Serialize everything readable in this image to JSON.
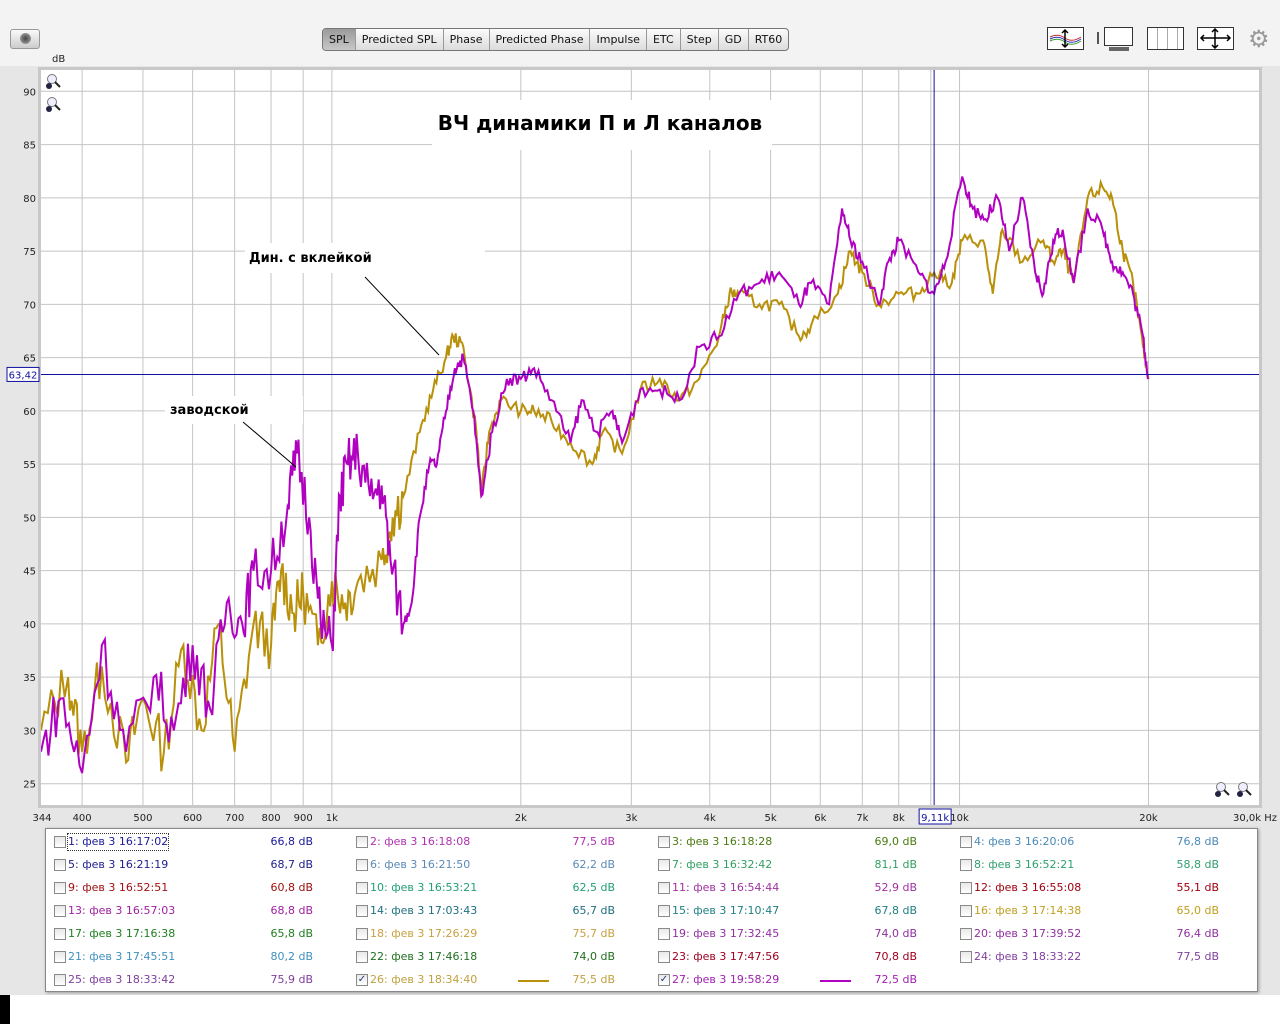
{
  "toolbar": {
    "tabs": [
      "SPL",
      "Predicted SPL",
      "Phase",
      "Predicted Phase",
      "Impulse",
      "ETC",
      "Step",
      "GD",
      "RT60"
    ],
    "selected_tab": "SPL",
    "left_icon": "camera-icon",
    "right_icons": [
      "trace-arrange-icon",
      "axis-limits-icon",
      "grid-lines-icon",
      "fit-all-icon",
      "gear-icon"
    ]
  },
  "graph": {
    "y_unit": "dB",
    "cursor": {
      "level": "63,42",
      "freq": "9,11k"
    },
    "annotations": {
      "title": "ВЧ динамики П и Л каналов",
      "label_glued": "Дин. с вклейкой",
      "label_factory": "заводской"
    }
  },
  "chart_data": {
    "type": "line",
    "title": "ВЧ динамики П и Л каналов",
    "xscale": "log",
    "xlim": [
      344,
      30000
    ],
    "ylim": [
      23,
      92
    ],
    "xlabel": "Hz",
    "ylabel": "dB",
    "grid": true,
    "yticks": [
      25,
      30,
      35,
      40,
      45,
      50,
      55,
      60,
      65,
      70,
      75,
      80,
      85,
      90
    ],
    "xticks": [
      {
        "v": 344,
        "l": "344"
      },
      {
        "v": 400,
        "l": "400"
      },
      {
        "v": 500,
        "l": "500"
      },
      {
        "v": 600,
        "l": "600"
      },
      {
        "v": 700,
        "l": "700"
      },
      {
        "v": 800,
        "l": "800"
      },
      {
        "v": 900,
        "l": "900"
      },
      {
        "v": 1000,
        "l": "1k"
      },
      {
        "v": 2000,
        "l": "2k"
      },
      {
        "v": 3000,
        "l": "3k"
      },
      {
        "v": 4000,
        "l": "4k"
      },
      {
        "v": 5000,
        "l": "5k"
      },
      {
        "v": 6000,
        "l": "6k"
      },
      {
        "v": 7000,
        "l": "7k"
      },
      {
        "v": 8000,
        "l": "8k"
      },
      {
        "v": 10000,
        "l": "10k"
      },
      {
        "v": 20000,
        "l": "20k"
      },
      {
        "v": 30000,
        "l": "30,0k Hz"
      }
    ],
    "gridx": [
      400,
      500,
      600,
      700,
      800,
      900,
      1000,
      2000,
      3000,
      4000,
      5000,
      6000,
      7000,
      8000,
      9000,
      10000,
      20000
    ],
    "cursor": {
      "x": 9110,
      "y": 63.42
    },
    "series": [
      {
        "name": "26: фев 3 18:34:40",
        "color": "#b8900a",
        "points": [
          [
            344,
            30
          ],
          [
            380,
            35
          ],
          [
            400,
            28
          ],
          [
            430,
            36
          ],
          [
            470,
            27
          ],
          [
            500,
            33
          ],
          [
            540,
            28
          ],
          [
            580,
            38
          ],
          [
            620,
            30
          ],
          [
            660,
            40
          ],
          [
            700,
            28
          ],
          [
            750,
            40
          ],
          [
            800,
            38
          ],
          [
            830,
            45
          ],
          [
            870,
            41
          ],
          [
            900,
            43
          ],
          [
            950,
            38
          ],
          [
            1000,
            44
          ],
          [
            1050,
            42
          ],
          [
            1100,
            44
          ],
          [
            1200,
            46
          ],
          [
            1250,
            50
          ],
          [
            1300,
            52
          ],
          [
            1380,
            58
          ],
          [
            1450,
            62
          ],
          [
            1520,
            65
          ],
          [
            1560,
            67
          ],
          [
            1620,
            66
          ],
          [
            1700,
            58
          ],
          [
            1730,
            52
          ],
          [
            1780,
            58
          ],
          [
            1860,
            61
          ],
          [
            2000,
            60
          ],
          [
            2100,
            60
          ],
          [
            2240,
            59
          ],
          [
            2400,
            57
          ],
          [
            2600,
            55
          ],
          [
            2700,
            58
          ],
          [
            2900,
            56
          ],
          [
            3100,
            62
          ],
          [
            3330,
            63
          ],
          [
            3580,
            61
          ],
          [
            3850,
            63
          ],
          [
            4140,
            67
          ],
          [
            4300,
            71
          ],
          [
            4450,
            71
          ],
          [
            4800,
            70
          ],
          [
            5160,
            70
          ],
          [
            5550,
            67
          ],
          [
            5800,
            68
          ],
          [
            6400,
            71
          ],
          [
            6700,
            75
          ],
          [
            7000,
            73
          ],
          [
            7430,
            70
          ],
          [
            8000,
            71
          ],
          [
            8600,
            71
          ],
          [
            9110,
            73
          ],
          [
            9720,
            72
          ],
          [
            10100,
            76
          ],
          [
            10900,
            76
          ],
          [
            11300,
            71
          ],
          [
            11700,
            77
          ],
          [
            12600,
            74
          ],
          [
            13600,
            76
          ],
          [
            14100,
            74
          ],
          [
            14600,
            75
          ],
          [
            15200,
            72
          ],
          [
            16000,
            80
          ],
          [
            16900,
            81
          ],
          [
            17500,
            80
          ],
          [
            18200,
            75
          ],
          [
            18900,
            72
          ],
          [
            19600,
            66
          ],
          [
            20000,
            63
          ]
        ]
      },
      {
        "name": "27: фев 3 19:58:29",
        "color": "#b000c0",
        "points": [
          [
            344,
            28
          ],
          [
            370,
            33
          ],
          [
            400,
            26
          ],
          [
            430,
            38
          ],
          [
            470,
            28
          ],
          [
            520,
            35
          ],
          [
            560,
            30
          ],
          [
            600,
            38
          ],
          [
            640,
            32
          ],
          [
            680,
            42
          ],
          [
            720,
            40
          ],
          [
            750,
            45
          ],
          [
            800,
            45
          ],
          [
            850,
            51
          ],
          [
            880,
            56
          ],
          [
            920,
            50
          ],
          [
            960,
            40
          ],
          [
            1000,
            38
          ],
          [
            1030,
            52
          ],
          [
            1060,
            55
          ],
          [
            1100,
            56
          ],
          [
            1150,
            52
          ],
          [
            1200,
            53
          ],
          [
            1240,
            46
          ],
          [
            1300,
            40
          ],
          [
            1340,
            42
          ],
          [
            1380,
            50
          ],
          [
            1430,
            55
          ],
          [
            1470,
            55
          ],
          [
            1520,
            60
          ],
          [
            1570,
            64
          ],
          [
            1620,
            65
          ],
          [
            1680,
            60
          ],
          [
            1730,
            52
          ],
          [
            1800,
            58
          ],
          [
            1900,
            63
          ],
          [
            2000,
            63
          ],
          [
            2100,
            64
          ],
          [
            2240,
            61
          ],
          [
            2400,
            57
          ],
          [
            2500,
            61
          ],
          [
            2650,
            58
          ],
          [
            2800,
            60
          ],
          [
            2900,
            57
          ],
          [
            3100,
            62
          ],
          [
            3330,
            62
          ],
          [
            3580,
            61
          ],
          [
            3850,
            66
          ],
          [
            4140,
            67
          ],
          [
            4450,
            71
          ],
          [
            4800,
            72
          ],
          [
            5160,
            73
          ],
          [
            5550,
            70
          ],
          [
            5800,
            72
          ],
          [
            6200,
            70
          ],
          [
            6500,
            79
          ],
          [
            6700,
            76
          ],
          [
            7000,
            74
          ],
          [
            7430,
            70
          ],
          [
            7700,
            74
          ],
          [
            8000,
            76
          ],
          [
            8600,
            73
          ],
          [
            9110,
            71
          ],
          [
            9500,
            74
          ],
          [
            10100,
            82
          ],
          [
            10500,
            79
          ],
          [
            11000,
            78
          ],
          [
            11500,
            80
          ],
          [
            12000,
            75
          ],
          [
            12600,
            80
          ],
          [
            13200,
            73
          ],
          [
            13600,
            71
          ],
          [
            14100,
            76
          ],
          [
            14600,
            77
          ],
          [
            15200,
            72
          ],
          [
            16000,
            79
          ],
          [
            16900,
            77
          ],
          [
            17500,
            74
          ],
          [
            18200,
            73
          ],
          [
            18900,
            71
          ],
          [
            19600,
            67
          ],
          [
            20000,
            63
          ]
        ]
      }
    ]
  },
  "legend": [
    {
      "label": "1: фев 3 16:17:02",
      "value": "66,8 dB",
      "color": "#1a1a9c",
      "checked": false
    },
    {
      "label": "2: фев 3 16:18:08",
      "value": "77,5 dB",
      "color": "#b030b0",
      "checked": false
    },
    {
      "label": "3: фев 3 16:18:28",
      "value": "69,0 dB",
      "color": "#4a7a10",
      "checked": false
    },
    {
      "label": "4: фев 3 16:20:06",
      "value": "76,8 dB",
      "color": "#4a8ab8",
      "checked": false
    },
    {
      "label": "5: фев 3 16:21:19",
      "value": "68,7 dB",
      "color": "#202090",
      "checked": false
    },
    {
      "label": "6: фев 3 16:21:50",
      "value": "62,2 dB",
      "color": "#5a8ab8",
      "checked": false
    },
    {
      "label": "7: фев 3 16:32:42",
      "value": "81,1 dB",
      "color": "#30a060",
      "checked": false
    },
    {
      "label": "8: фев 3 16:52:21",
      "value": "58,8 dB",
      "color": "#30a070",
      "checked": false
    },
    {
      "label": "9: фев 3 16:52:51",
      "value": "60,8 dB",
      "color": "#a01010",
      "checked": false
    },
    {
      "label": "10: фев 3 16:53:21",
      "value": "62,5 dB",
      "color": "#20a070",
      "checked": false
    },
    {
      "label": "11: фев 3 16:54:44",
      "value": "52,9 dB",
      "color": "#a030a0",
      "checked": false
    },
    {
      "label": "12: фев 3 16:55:08",
      "value": "55,1 dB",
      "color": "#a00010",
      "checked": false
    },
    {
      "label": "13: фев 3 16:57:03",
      "value": "68,8 dB",
      "color": "#a020a0",
      "checked": false
    },
    {
      "label": "14: фев 3 17:03:43",
      "value": "65,7 dB",
      "color": "#207080",
      "checked": false
    },
    {
      "label": "15: фев 3 17:10:47",
      "value": "67,8 dB",
      "color": "#208080",
      "checked": false
    },
    {
      "label": "16: фев 3 17:14:38",
      "value": "65,0 dB",
      "color": "#c0a020",
      "checked": false
    },
    {
      "label": "17: фев 3 17:16:38",
      "value": "65,8 dB",
      "color": "#208020",
      "checked": false
    },
    {
      "label": "18: фев 3 17:26:29",
      "value": "75,7 dB",
      "color": "#c8a040",
      "checked": false
    },
    {
      "label": "19: фев 3 17:32:45",
      "value": "74,0 dB",
      "color": "#9030a0",
      "checked": false
    },
    {
      "label": "20: фев 3 17:39:52",
      "value": "76,4 dB",
      "color": "#9030a0",
      "checked": false
    },
    {
      "label": "21: фев 3 17:45:51",
      "value": "80,2 dB",
      "color": "#4090c0",
      "checked": false
    },
    {
      "label": "22: фев 3 17:46:18",
      "value": "74,0 dB",
      "color": "#207020",
      "checked": false
    },
    {
      "label": "23: фев 3 17:47:56",
      "value": "70,8 dB",
      "color": "#a00020",
      "checked": false
    },
    {
      "label": "24: фев 3 18:33:22",
      "value": "77,5 dB",
      "color": "#8040a0",
      "checked": false
    },
    {
      "label": "25: фев 3 18:33:42",
      "value": "75,9 dB",
      "color": "#8040a0",
      "checked": false
    },
    {
      "label": "26: фев 3 18:34:40",
      "value": "75,5 dB",
      "color": "#c0a040",
      "checked": true,
      "line_color": "#b8900a"
    },
    {
      "label": "27: фев 3 19:58:29",
      "value": "72,5 dB",
      "color": "#a020b0",
      "checked": true,
      "line_color": "#b000c0"
    }
  ]
}
